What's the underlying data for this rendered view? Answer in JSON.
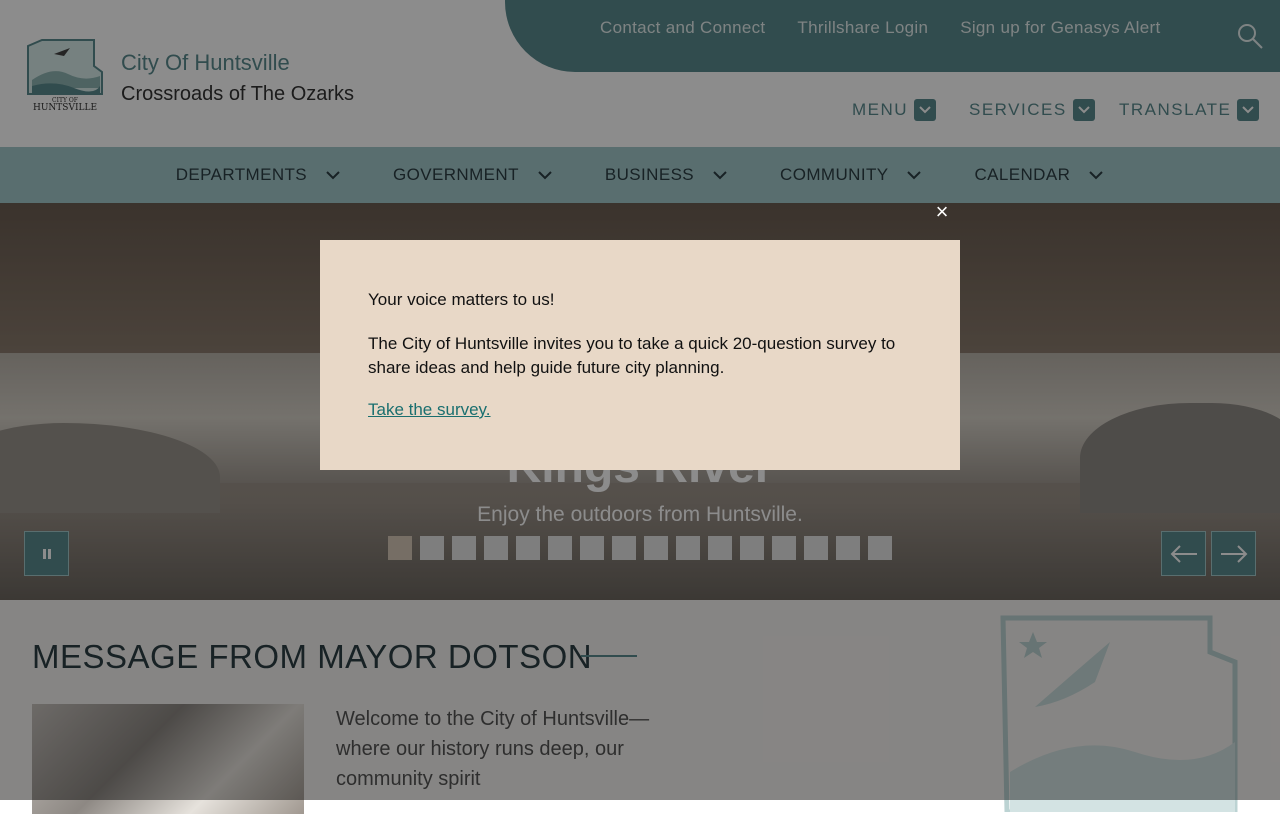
{
  "header": {
    "utility_links": [
      "Contact and Connect",
      "Thrillshare Login",
      "Sign up for Genasys Alert"
    ],
    "site_title": "City Of Huntsville",
    "site_tagline": "Crossroads of The Ozarks",
    "logo_text": "CITY OF HUNTSVILLE",
    "menu_label": "MENU",
    "services_label": "SERVICES",
    "translate_label": "TRANSLATE"
  },
  "nav": {
    "items": [
      "DEPARTMENTS",
      "GOVERNMENT",
      "BUSINESS",
      "COMMUNITY",
      "CALENDAR"
    ]
  },
  "hero": {
    "title": "Kings River",
    "subtitle": "Enjoy the outdoors from Huntsville.",
    "slide_count": 16,
    "active_slide": 1
  },
  "mayor": {
    "heading": "MESSAGE FROM MAYOR DOTSON",
    "text": "Welcome to the City of Huntsville—where our history runs deep, our community spirit"
  },
  "modal": {
    "line1": "Your voice matters to us!",
    "line2": "The City of Huntsville invites you to take a quick 20-question survey to share ideas and help guide future city planning.",
    "link": "Take the survey.",
    "close_glyph": "×"
  },
  "colors": {
    "brand_teal": "#5a8a8e",
    "nav_bg": "#a3c8cb",
    "modal_bg": "#e8d8c7"
  }
}
